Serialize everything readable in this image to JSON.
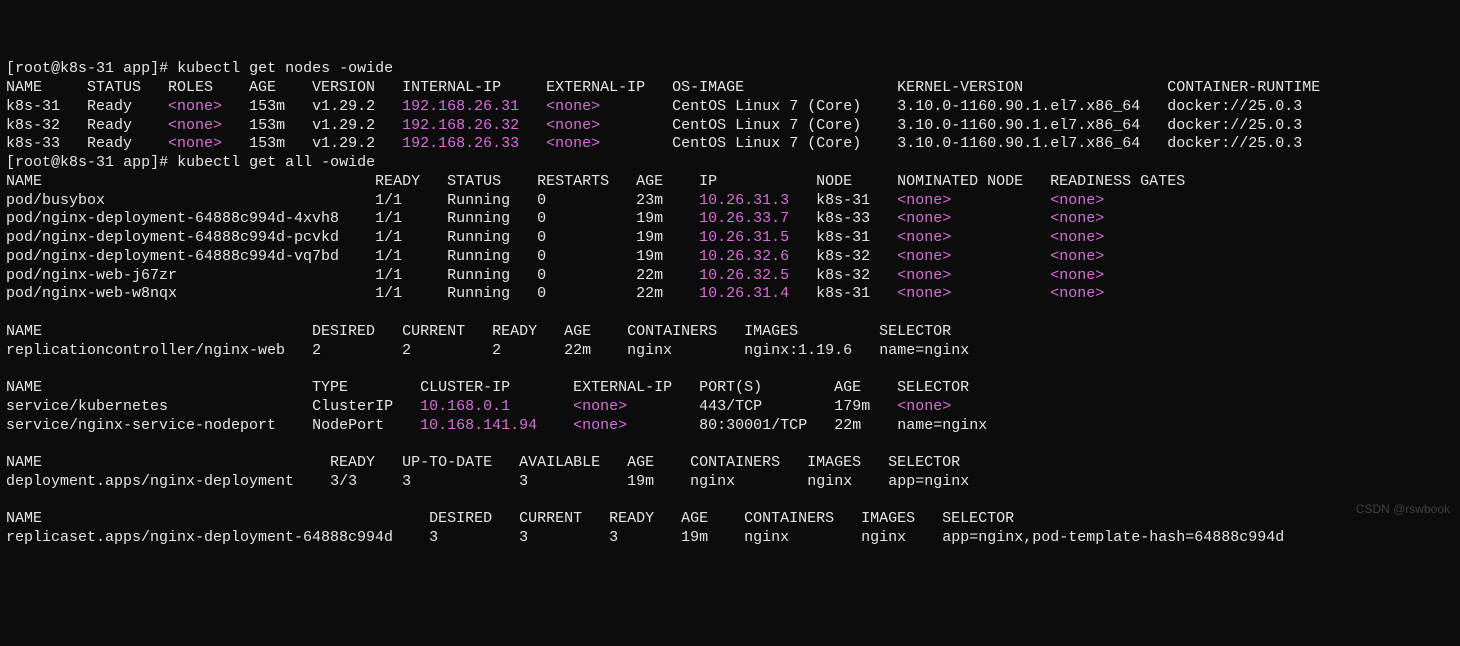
{
  "prompt1": {
    "user": "root",
    "host": "k8s-31",
    "dir": "app",
    "cmd": "kubectl get nodes -owide"
  },
  "nodes": {
    "header": {
      "name": "NAME",
      "status": "STATUS",
      "roles": "ROLES",
      "age": "AGE",
      "version": "VERSION",
      "internal_ip": "INTERNAL-IP",
      "external_ip": "EXTERNAL-IP",
      "os_image": "OS-IMAGE",
      "kernel": "KERNEL-VERSION",
      "runtime": "CONTAINER-RUNTIME"
    },
    "rows": [
      {
        "name": "k8s-31",
        "status": "Ready",
        "roles": "<none>",
        "age": "153m",
        "version": "v1.29.2",
        "internal_ip": "192.168.26.31",
        "external_ip": "<none>",
        "os_image": "CentOS Linux 7 (Core)",
        "kernel": "3.10.0-1160.90.1.el7.x86_64",
        "runtime": "docker://25.0.3"
      },
      {
        "name": "k8s-32",
        "status": "Ready",
        "roles": "<none>",
        "age": "153m",
        "version": "v1.29.2",
        "internal_ip": "192.168.26.32",
        "external_ip": "<none>",
        "os_image": "CentOS Linux 7 (Core)",
        "kernel": "3.10.0-1160.90.1.el7.x86_64",
        "runtime": "docker://25.0.3"
      },
      {
        "name": "k8s-33",
        "status": "Ready",
        "roles": "<none>",
        "age": "153m",
        "version": "v1.29.2",
        "internal_ip": "192.168.26.33",
        "external_ip": "<none>",
        "os_image": "CentOS Linux 7 (Core)",
        "kernel": "3.10.0-1160.90.1.el7.x86_64",
        "runtime": "docker://25.0.3"
      }
    ]
  },
  "prompt2": {
    "user": "root",
    "host": "k8s-31",
    "dir": "app",
    "cmd": "kubectl get all -owide"
  },
  "pods": {
    "header": {
      "name": "NAME",
      "ready": "READY",
      "status": "STATUS",
      "restarts": "RESTARTS",
      "age": "AGE",
      "ip": "IP",
      "node": "NODE",
      "nominated": "NOMINATED NODE",
      "gates": "READINESS GATES"
    },
    "rows": [
      {
        "name": "pod/busybox",
        "ready": "1/1",
        "status": "Running",
        "restarts": "0",
        "age": "23m",
        "ip": "10.26.31.3",
        "node": "k8s-31",
        "nominated": "<none>",
        "gates": "<none>"
      },
      {
        "name": "pod/nginx-deployment-64888c994d-4xvh8",
        "ready": "1/1",
        "status": "Running",
        "restarts": "0",
        "age": "19m",
        "ip": "10.26.33.7",
        "node": "k8s-33",
        "nominated": "<none>",
        "gates": "<none>"
      },
      {
        "name": "pod/nginx-deployment-64888c994d-pcvkd",
        "ready": "1/1",
        "status": "Running",
        "restarts": "0",
        "age": "19m",
        "ip": "10.26.31.5",
        "node": "k8s-31",
        "nominated": "<none>",
        "gates": "<none>"
      },
      {
        "name": "pod/nginx-deployment-64888c994d-vq7bd",
        "ready": "1/1",
        "status": "Running",
        "restarts": "0",
        "age": "19m",
        "ip": "10.26.32.6",
        "node": "k8s-32",
        "nominated": "<none>",
        "gates": "<none>"
      },
      {
        "name": "pod/nginx-web-j67zr",
        "ready": "1/1",
        "status": "Running",
        "restarts": "0",
        "age": "22m",
        "ip": "10.26.32.5",
        "node": "k8s-32",
        "nominated": "<none>",
        "gates": "<none>"
      },
      {
        "name": "pod/nginx-web-w8nqx",
        "ready": "1/1",
        "status": "Running",
        "restarts": "0",
        "age": "22m",
        "ip": "10.26.31.4",
        "node": "k8s-31",
        "nominated": "<none>",
        "gates": "<none>"
      }
    ]
  },
  "rc": {
    "header": {
      "name": "NAME",
      "desired": "DESIRED",
      "current": "CURRENT",
      "ready": "READY",
      "age": "AGE",
      "containers": "CONTAINERS",
      "images": "IMAGES",
      "selector": "SELECTOR"
    },
    "rows": [
      {
        "name": "replicationcontroller/nginx-web",
        "desired": "2",
        "current": "2",
        "ready": "2",
        "age": "22m",
        "containers": "nginx",
        "images": "nginx:1.19.6",
        "selector": "name=nginx"
      }
    ]
  },
  "svc": {
    "header": {
      "name": "NAME",
      "type": "TYPE",
      "cluster_ip": "CLUSTER-IP",
      "external_ip": "EXTERNAL-IP",
      "ports": "PORT(S)",
      "age": "AGE",
      "selector": "SELECTOR"
    },
    "rows": [
      {
        "name": "service/kubernetes",
        "type": "ClusterIP",
        "cluster_ip": "10.168.0.1",
        "external_ip": "<none>",
        "ports": "443/TCP",
        "age": "179m",
        "selector": "<none>"
      },
      {
        "name": "service/nginx-service-nodeport",
        "type": "NodePort",
        "cluster_ip": "10.168.141.94",
        "external_ip": "<none>",
        "ports": "80:30001/TCP",
        "age": "22m",
        "selector": "name=nginx"
      }
    ]
  },
  "deploy": {
    "header": {
      "name": "NAME",
      "ready": "READY",
      "uptodate": "UP-TO-DATE",
      "available": "AVAILABLE",
      "age": "AGE",
      "containers": "CONTAINERS",
      "images": "IMAGES",
      "selector": "SELECTOR"
    },
    "rows": [
      {
        "name": "deployment.apps/nginx-deployment",
        "ready": "3/3",
        "uptodate": "3",
        "available": "3",
        "age": "19m",
        "containers": "nginx",
        "images": "nginx",
        "selector": "app=nginx"
      }
    ]
  },
  "rs": {
    "header": {
      "name": "NAME",
      "desired": "DESIRED",
      "current": "CURRENT",
      "ready": "READY",
      "age": "AGE",
      "containers": "CONTAINERS",
      "images": "IMAGES",
      "selector": "SELECTOR"
    },
    "rows": [
      {
        "name": "replicaset.apps/nginx-deployment-64888c994d",
        "desired": "3",
        "current": "3",
        "ready": "3",
        "age": "19m",
        "containers": "nginx",
        "images": "nginx",
        "selector": "app=nginx,pod-template-hash=64888c994d"
      }
    ]
  },
  "watermark": "CSDN @rswbook"
}
